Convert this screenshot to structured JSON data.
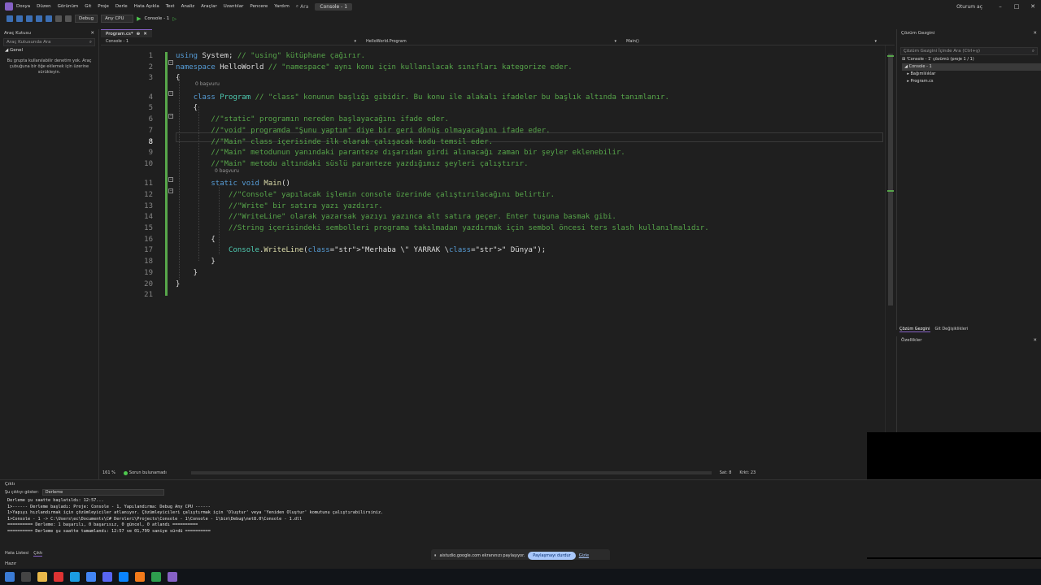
{
  "menu": {
    "items": [
      "Dosya",
      "Düzen",
      "Görünüm",
      "Git",
      "Proje",
      "Derle",
      "Hata Ayıkla",
      "Test",
      "Analiz",
      "Araçlar",
      "Uzantılar",
      "Pencere",
      "Yardım"
    ],
    "search_label": "Ara",
    "title": "Console - 1",
    "user": "Oturum aç"
  },
  "toolbar": {
    "config": "Debug",
    "platform": "Any CPU",
    "run_label": "Console - 1"
  },
  "toolbox": {
    "title": "Araç Kutusu",
    "search_placeholder": "Araç Kutusunda Ara",
    "group": "Genel",
    "empty_text": "Bu grupta kullanılabilir denetim yok. Araç çubuğuna bir öğe eklemek için üzerine sürükleyin."
  },
  "editor": {
    "tab_label": "Program.cs*",
    "nav_project": "Console - 1",
    "nav_class": "HelloWorld.Program",
    "nav_member": "Main()",
    "codelens1": "0 başvuru",
    "codelens2": "0 başvuru",
    "line_numbers": [
      "1",
      "2",
      "3",
      "4",
      "5",
      "6",
      "7",
      "8",
      "9",
      "10",
      "11",
      "12",
      "13",
      "14",
      "15",
      "16",
      "17",
      "18",
      "19",
      "20",
      "21"
    ],
    "lines": [
      "using System; // \"using\" kütüphane çağırır.",
      "namespace HelloWorld // \"namespace\" aynı konu için kullanılacak sınıfları kategorize eder.",
      "{",
      "    class Program // \"class\" konunun başlığı gibidir. Bu konu ile alakalı ifadeler bu başlık altında tanımlanır.",
      "    {",
      "        //\"static\" programın nereden başlayacağını ifade eder.",
      "        //\"void\" programda \"Şunu yaptım\" diye bir geri dönüş olmayacağını ifade eder.",
      "        //\"Main\" class içerisinde ilk olarak çalışacak kodu temsil eder.",
      "        //\"Main\" metodunun yanındaki paranteze dışarıdan girdi alınacağı zaman bir şeyler eklenebilir.",
      "        //\"Main\" metodu altındaki süslü paranteze yazdığımız şeyleri çalıştırır.",
      "        static void Main()",
      "            //\"Console\" yapılacak işlemin console üzerinde çalıştırılacağını belirtir.",
      "            //\"Write\" bir satıra yazı yazdırır.",
      "            //\"WriteLine\" olarak yazarsak yazıyı yazınca alt satıra geçer. Enter tuşuna basmak gibi.",
      "            //String içerisindeki sembolleri programa takılmadan yazdırmak için sembol öncesi ters slash kullanılmalıdır.",
      "        {",
      "            Console.WriteLine(\"Merhaba \\\" YARRAK \\\" Dünya\");",
      "        }",
      "    }",
      "}",
      ""
    ],
    "zoom": "161 %",
    "issues": "Sorun bulunamadı",
    "line_pos": "Sat: 8",
    "char_pos": "Krkt: 23"
  },
  "solution": {
    "title": "Çözüm Gezgini",
    "search_placeholder": "Çözüm Gezgini İçinde Ara (Ctrl+ş)",
    "items": [
      "'Console - 1' çözümü (proje 1 / 1)",
      "Console - 1",
      "Bağımlılıklar",
      "Program.cs"
    ],
    "tab1": "Çözüm Gezgini",
    "tab2": "Git Değişiklikleri",
    "props_title": "Özellikler"
  },
  "output": {
    "title": "Çıktı",
    "show_label": "Şu çıktıyı göster:",
    "show_value": "Derleme",
    "lines": [
      "Derleme şu saatte başlatıldı: 12:57...",
      "1>------ Derleme başladı: Proje: Console - 1, Yapılandırma: Debug Any CPU ------",
      "1>Yapıyı hızlandırmak için çözümleyiciler atlanıyor. Çözümleyicileri çalıştırmak için 'Oluştur' veya 'Yeniden Oluştur' komutunu çalıştırabilirsiniz.",
      "1>Console - 1 -> C:\\Users\\ec\\Documents\\C# Dersleri\\Projects\\Console - 1\\Console - 1\\bin\\Debug\\net8.0\\Console - 1.dll",
      "========== Derleme: 1 başarılı, 0 başarısız, 0 güncel, 0 atlandı ==========",
      "========== Derleme şu saatte tamamlandı: 12:57 ve 01,799 saniye sürdü =========="
    ]
  },
  "bottom_tabs": [
    "Hata Listesi",
    "Çıktı"
  ],
  "share": {
    "text": "aistudio.google.com ekranınızı paylaşıyor.",
    "stop": "Paylaşmayı durdur",
    "hide": "Gizle"
  },
  "status": "Hazır",
  "colors": {
    "accent": "#8661c5",
    "keyword": "#569cd6",
    "comment": "#57a64a",
    "string": "#d69d85",
    "type": "#4ec9b0",
    "method": "#dcdcaa"
  }
}
